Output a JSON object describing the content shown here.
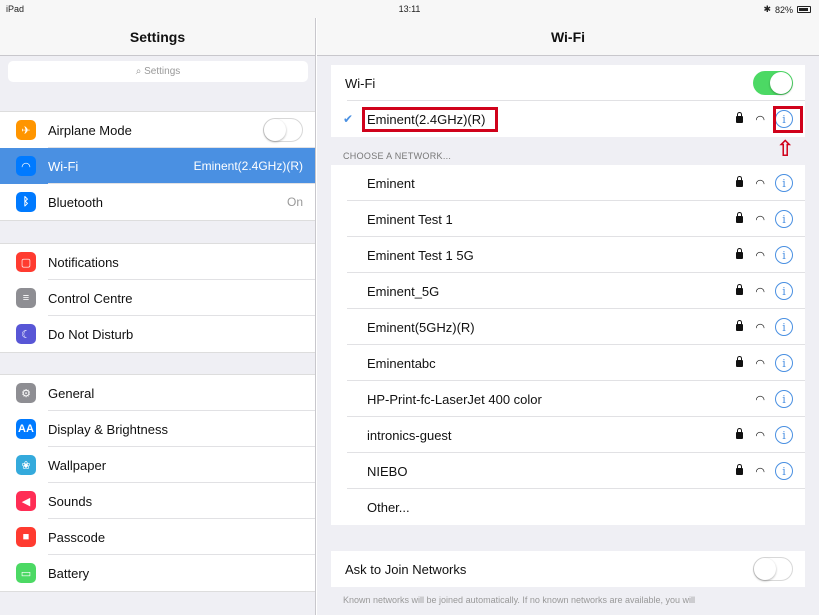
{
  "status": {
    "device": "iPad",
    "time": "13:11",
    "battery": "82%"
  },
  "sidebar": {
    "title": "Settings",
    "search_placeholder": "Settings",
    "group1": [
      {
        "label": "Airplane Mode",
        "icon": "airplane-icon",
        "color": "#ff9500",
        "toggle": "off"
      },
      {
        "label": "Wi-Fi",
        "value": "Eminent(2.4GHz)(R)",
        "icon": "wifi-icon",
        "color": "#007aff",
        "selected": true
      },
      {
        "label": "Bluetooth",
        "value": "On",
        "icon": "bluetooth-icon",
        "color": "#007aff"
      }
    ],
    "group2": [
      {
        "label": "Notifications",
        "icon": "notifications-icon",
        "color": "#ff3b30"
      },
      {
        "label": "Control Centre",
        "icon": "control-centre-icon",
        "color": "#8e8e93"
      },
      {
        "label": "Do Not Disturb",
        "icon": "moon-icon",
        "color": "#5856d6"
      }
    ],
    "group3": [
      {
        "label": "General",
        "icon": "gear-icon",
        "color": "#8e8e93"
      },
      {
        "label": "Display & Brightness",
        "icon": "brightness-icon",
        "color": "#007aff"
      },
      {
        "label": "Wallpaper",
        "icon": "wallpaper-icon",
        "color": "#34aadc"
      },
      {
        "label": "Sounds",
        "icon": "sounds-icon",
        "color": "#ff2d55"
      },
      {
        "label": "Passcode",
        "icon": "lock-icon",
        "color": "#ff3b30"
      },
      {
        "label": "Battery",
        "icon": "battery-icon",
        "color": "#4cd964"
      }
    ]
  },
  "detail": {
    "title": "Wi-Fi",
    "wifi_label": "Wi-Fi",
    "connected": "Eminent(2.4GHz)(R)",
    "section_header": "CHOOSE A NETWORK...",
    "networks": [
      {
        "name": "Eminent",
        "locked": true
      },
      {
        "name": "Eminent Test 1",
        "locked": true
      },
      {
        "name": "Eminent Test 1 5G",
        "locked": true
      },
      {
        "name": "Eminent_5G",
        "locked": true
      },
      {
        "name": "Eminent(5GHz)(R)",
        "locked": true
      },
      {
        "name": "Eminentabc",
        "locked": true
      },
      {
        "name": "HP-Print-fc-LaserJet 400 color",
        "locked": false
      },
      {
        "name": "intronics-guest",
        "locked": true
      },
      {
        "name": "NIEBO",
        "locked": true
      }
    ],
    "other_label": "Other...",
    "ask_label": "Ask to Join Networks",
    "footer": "Known networks will be joined automatically. If no known networks are available, you will"
  },
  "colors": {
    "accent": "#4a90e2",
    "highlight": "#d0021b",
    "toggle_on": "#4cd964"
  }
}
